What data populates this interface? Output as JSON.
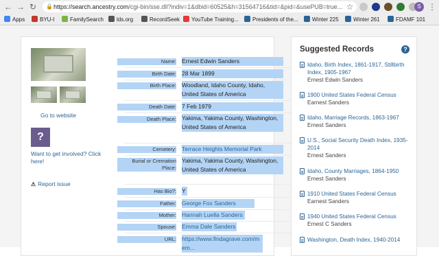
{
  "browser": {
    "url_host": "https://search.ancestry.com",
    "url_path": "/cgi-bin/sse.dll?indiv=1&dbid=60525&h=31564716&tid=&pid=&usePUB=true...",
    "profile_initial": "S"
  },
  "bookmarks": [
    {
      "label": "Apps",
      "color": "#4285f4"
    },
    {
      "label": "BYU-I",
      "color": "#c0392b"
    },
    {
      "label": "FamilySearch",
      "color": "#7cb342"
    },
    {
      "label": "lds.org",
      "color": "#555555"
    },
    {
      "label": "RecordSeek",
      "color": "#555555"
    },
    {
      "label": "YouTube Training...",
      "color": "#e53935"
    },
    {
      "label": "Presidents of the...",
      "color": "#2a6496"
    },
    {
      "label": "Winter 225",
      "color": "#2a6496"
    },
    {
      "label": "Winter 261",
      "color": "#2a6496"
    },
    {
      "label": "FDAMF 101",
      "color": "#2a6496"
    }
  ],
  "left": {
    "goto_website": "Go to website",
    "involved": "Want to get involved? Click here!",
    "report": "Report issue",
    "avatar_glyph": "?"
  },
  "record": {
    "name_label": "Name:",
    "name": "Ernest Edwin Sanders",
    "birth_date_label": "Birth Date:",
    "birth_date": "28 Mar 1899",
    "birth_place_label": "Birth Place:",
    "birth_place": "Woodland, Idaho County, Idaho, United States of America",
    "death_date_label": "Death Date:",
    "death_date": "7 Feb 1979",
    "death_place_label": "Death Place:",
    "death_place": "Yakima, Yakima County, Washington, United States of America",
    "cemetery_label": "Cemetery:",
    "cemetery": "Terrace Heights Memorial Park",
    "burial_label": "Burial or Cremation Place:",
    "burial": "Yakima, Yakima County, Washington, United States of America",
    "bio_label": "Has Bio?:",
    "bio": "Y",
    "father_label": "Father:",
    "father": "George Fox Sanders",
    "mother_label": "Mother:",
    "mother": "Hannah Luella Sanders",
    "spouse_label": "Spouse:",
    "spouse": "Emma Dale Sanders",
    "url_label": "URL:",
    "url": "https://www.findagrave.com/mem..."
  },
  "suggested": {
    "title": "Suggested Records",
    "items": [
      {
        "title": "Idaho, Birth Index, 1861-1917, Stillbirth Index, 1905-1967",
        "name": "Ernest Edwin Sanders"
      },
      {
        "title": "1900 United States Federal Census",
        "name": "Earnest Sanders"
      },
      {
        "title": "Idaho, Marriage Records, 1863-1967",
        "name": "Ernest Sanders"
      },
      {
        "title": "U.S., Social Security Death Index, 1935-2014",
        "name": "Ernest Sanders"
      },
      {
        "title": "Idaho, County Marriages, 1864-1950",
        "name": "Ernest Sanders"
      },
      {
        "title": "1910 United States Federal Census",
        "name": "Earnest Sanders"
      },
      {
        "title": "1940 United States Federal Census",
        "name": "Ernest C Sanders"
      },
      {
        "title": "Washington, Death Index, 1940-2014",
        "name": ""
      }
    ]
  }
}
